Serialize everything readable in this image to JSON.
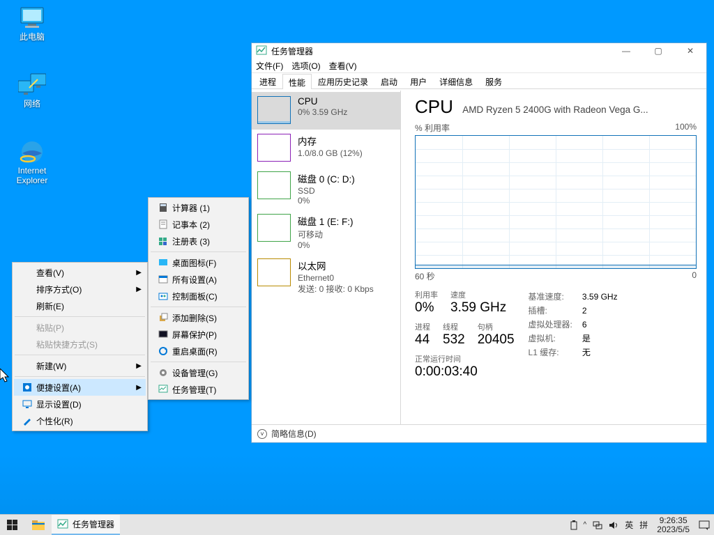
{
  "desktop_icons": {
    "this_pc": "此电脑",
    "network": "网络",
    "ie1": "Internet",
    "ie2": "Explorer"
  },
  "context_menu1": {
    "view": "查看(V)",
    "sort": "排序方式(O)",
    "refresh": "刷新(E)",
    "paste": "粘贴(P)",
    "paste_shortcut": "粘贴快捷方式(S)",
    "new": "新建(W)",
    "quick_settings": "便捷设置(A)",
    "display": "显示设置(D)",
    "personalize": "个性化(R)"
  },
  "context_menu2": {
    "calc": "计算器  (1)",
    "notepad": "记事本  (2)",
    "regedit": "注册表  (3)",
    "desk_icons": "桌面图标(F)",
    "all_settings": "所有设置(A)",
    "control_panel": "控制面板(C)",
    "add_remove": "添加删除(S)",
    "screensaver": "屏幕保护(P)",
    "restart_desk": "重启桌面(R)",
    "device_mgr": "设备管理(G)",
    "task_mgr": "任务管理(T)"
  },
  "tm": {
    "title": "任务管理器",
    "menu_file": "文件(F)",
    "menu_options": "选项(O)",
    "menu_view": "查看(V)",
    "tabs": {
      "processes": "进程",
      "performance": "性能",
      "app_history": "应用历史记录",
      "startup": "启动",
      "users": "用户",
      "details": "详细信息",
      "services": "服务"
    },
    "list": {
      "cpu_t": "CPU",
      "cpu_s": "0% 3.59 GHz",
      "mem_t": "内存",
      "mem_s": "1.0/8.0 GB (12%)",
      "disk0_t": "磁盘 0 (C: D:)",
      "disk0_s1": "SSD",
      "disk0_s2": "0%",
      "disk1_t": "磁盘 1 (E: F:)",
      "disk1_s1": "可移动",
      "disk1_s2": "0%",
      "eth_t": "以太网",
      "eth_s1": "Ethernet0",
      "eth_s2": "发送: 0 接收: 0 Kbps"
    },
    "right": {
      "heading": "CPU",
      "name": "AMD Ryzen 5 2400G with Radeon Vega G...",
      "util_label": "% 利用率",
      "hundred": "100%",
      "x_left": "60 秒",
      "x_right": "0",
      "labels": {
        "util": "利用率",
        "speed": "速度",
        "base": "基准速度:",
        "sockets": "插槽:",
        "vproc": "虚拟处理器:",
        "vm": "虚拟机:",
        "l1": "L1 缓存:",
        "proc": "进程",
        "threads": "线程",
        "handles": "句柄",
        "uptime": "正常运行时间"
      },
      "vals": {
        "util": "0%",
        "speed": "3.59 GHz",
        "base": "3.59 GHz",
        "sockets": "2",
        "vproc": "6",
        "vm": "是",
        "l1": "无",
        "proc": "44",
        "threads": "532",
        "handles": "20405",
        "uptime": "0:00:03:40"
      }
    },
    "bottom": "简略信息(D)"
  },
  "taskbar": {
    "task_tm": "任务管理器",
    "ime1": "英",
    "ime2": "拼",
    "time": "9:26:35",
    "date": "2023/5/5"
  },
  "colors": {
    "cpu": "#1172b8",
    "mem": "#8b20b6",
    "disk": "#3fa447",
    "eth": "#b88a00"
  },
  "chart_data": {
    "type": "line",
    "title": "CPU % 利用率",
    "xlabel": "秒",
    "ylabel": "% 利用率",
    "xlim": [
      60,
      0
    ],
    "ylim": [
      0,
      100
    ],
    "x": [
      60,
      55,
      50,
      45,
      40,
      35,
      30,
      25,
      20,
      15,
      10,
      5,
      0
    ],
    "values": [
      0,
      0,
      0,
      0,
      0,
      1,
      0,
      0,
      0,
      1,
      0,
      1,
      0
    ]
  }
}
